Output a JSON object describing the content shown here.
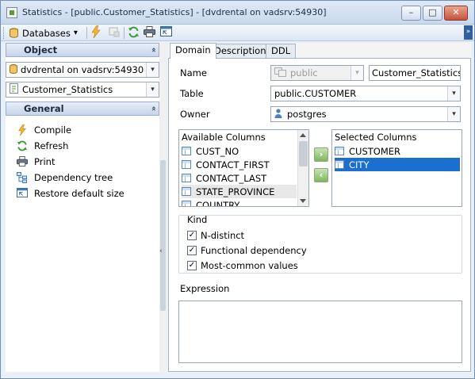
{
  "window": {
    "title": "Statistics - [public.Customer_Statistics] - [dvdrental on vadsrv:54930]",
    "min_glyph": "–",
    "max_glyph": "□",
    "close_glyph": "✕"
  },
  "toolbar": {
    "databases_label": "Databases",
    "dropdown_glyph": "▾",
    "overflow_glyph": "»",
    "icons": [
      "compile-icon",
      "refresh-icon",
      "print-icon",
      "restore-size-icon"
    ]
  },
  "sidebar": {
    "object_header": "Object",
    "collapse_glyph": "«",
    "database_combo": "dvdrental on vadsrv:54930",
    "statistics_combo": "Customer_Statistics",
    "general_header": "General",
    "tasks": [
      {
        "label": "Compile",
        "icon": "lightning-icon"
      },
      {
        "label": "Refresh",
        "icon": "refresh-icon"
      },
      {
        "label": "Print",
        "icon": "printer-icon"
      },
      {
        "label": "Dependency tree",
        "icon": "tree-icon"
      },
      {
        "label": "Restore default size",
        "icon": "restore-size-icon"
      }
    ]
  },
  "splitter": {
    "grip_glyph": "‹"
  },
  "tabs": [
    {
      "label": "Domain",
      "active": true
    },
    {
      "label": "Description",
      "active": false
    },
    {
      "label": "DDL",
      "active": false
    }
  ],
  "form": {
    "name_label": "Name",
    "schema_value": "public",
    "name_value": "Customer_Statistics",
    "table_label": "Table",
    "table_value": "public.CUSTOMER",
    "owner_label": "Owner",
    "owner_value": "postgres",
    "available_header": "Available Columns",
    "available_columns": [
      "CUST_NO",
      "CONTACT_FIRST",
      "CONTACT_LAST",
      "STATE_PROVINCE",
      "COUNTRY"
    ],
    "selected_header": "Selected Columns",
    "selected_columns": [
      "CUSTOMER",
      "CITY"
    ],
    "selected_index": 1,
    "move_right_glyph": "›",
    "move_left_glyph": "‹",
    "kind_label": "Kind",
    "kinds": [
      {
        "label": "N-distinct",
        "checked": true
      },
      {
        "label": "Functional dependency",
        "checked": true
      },
      {
        "label": "Most-common values",
        "checked": true
      }
    ],
    "check_glyph": "✓",
    "expression_label": "Expression",
    "expression_value": ""
  },
  "colors": {
    "selection": "#1c6fd1",
    "title_gradient_top": "#dfe9f5",
    "close_button": "#c5533a"
  }
}
